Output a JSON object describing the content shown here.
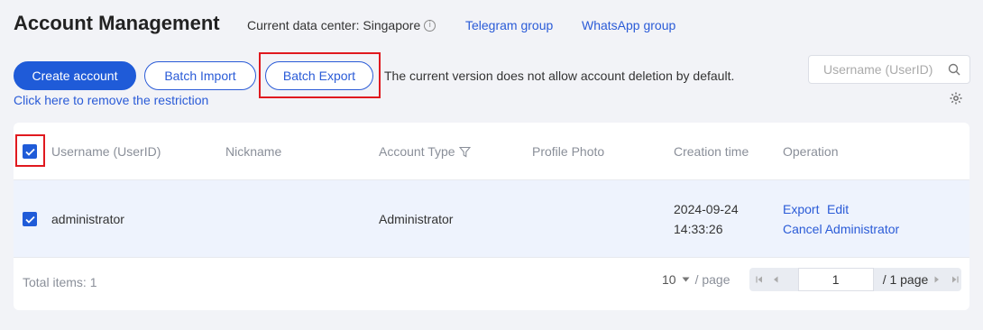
{
  "header": {
    "title": "Account Management",
    "data_center": "Current data center: Singapore",
    "info_glyph": "i",
    "links": [
      "Telegram group",
      "WhatsApp group"
    ]
  },
  "toolbar": {
    "create_label": "Create account",
    "import_label": "Batch Import",
    "export_label": "Batch Export",
    "notice": "The current version does not allow account deletion by default.",
    "restriction_link": "Click here to remove the restriction",
    "search_placeholder": "Username (UserID)"
  },
  "table": {
    "columns": [
      "Username (UserID)",
      "Nickname",
      "Account Type",
      "Profile Photo",
      "Creation time",
      "Operation"
    ],
    "rows": [
      {
        "username": "administrator",
        "nickname": "",
        "account_type": "Administrator",
        "creation_date": "2024-09-24",
        "creation_time": "14:33:26",
        "ops": [
          "Export",
          "Edit",
          "Cancel Administrator"
        ],
        "checked": true
      }
    ]
  },
  "footer": {
    "total": "Total items: 1",
    "page_size": "10",
    "page_size_suffix": "/ page",
    "current_page": "1",
    "total_pages": "/ 1 page"
  },
  "colors": {
    "accent": "#1f5bd8",
    "highlight": "#e0191f",
    "row_selected": "#eef3fd"
  }
}
